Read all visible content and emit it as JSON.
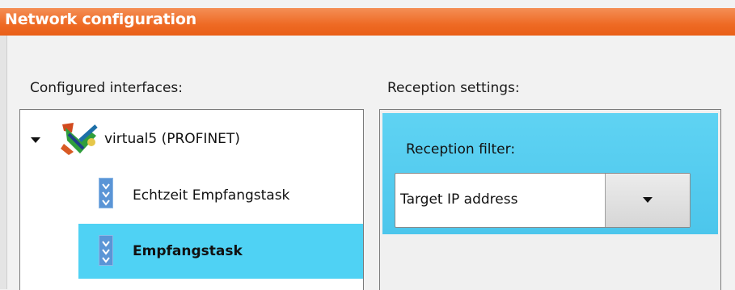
{
  "window": {
    "title": "Network configuration"
  },
  "left": {
    "heading": "Configured interfaces:",
    "interface": {
      "label": "virtual5 (PROFINET)",
      "icon": "network-interface-icon"
    },
    "tasks": [
      {
        "label": "Echtzeit Empfangstask",
        "icon": "receive-task-icon",
        "selected": false
      },
      {
        "label": "Empfangstask",
        "icon": "receive-task-icon",
        "selected": true
      }
    ]
  },
  "right": {
    "heading": "Reception settings:",
    "filter": {
      "label": "Reception filter:",
      "value": "Target IP address"
    }
  },
  "colors": {
    "titlebar": "#ee6a24",
    "selection": "#4fd2f4",
    "panel_header": "#5fd3f3"
  }
}
